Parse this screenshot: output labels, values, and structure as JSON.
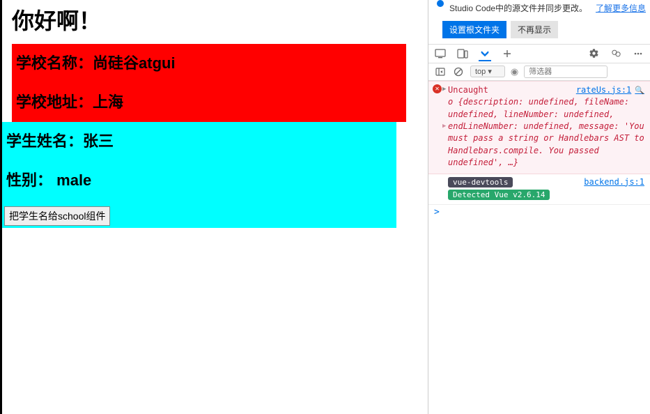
{
  "page": {
    "title": "你好啊！",
    "school": {
      "name_label": "学校名称：",
      "name_value": "尚硅谷atgui",
      "addr_label": "学校地址：",
      "addr_value": "上海"
    },
    "student": {
      "name_label": "学生姓名：",
      "name_value": "张三",
      "sex_label": "性别：",
      "sex_value": "male",
      "button": "把学生名给school组件"
    }
  },
  "devtools": {
    "vscode_hint": "Studio Code中的源文件并同步更改。",
    "vscode_more": "了解更多信息",
    "btn_set_root": "设置根文件夹",
    "btn_dismiss": "不再显示",
    "frame_select": "top",
    "filter_placeholder": "筛选器",
    "error": {
      "title": "Uncaught",
      "source": "rateUs.js:1",
      "body": "o {description: undefined, fileName: undefined, lineNumber: undefined, endLineNumber: undefined, message: 'You must pass a string or Handlebars AST to Handlebars.compile. You passed undefined', …}"
    },
    "vue_msg": {
      "badge1": "vue-devtools",
      "badge2": "Detected Vue v2.6.14",
      "source": "backend.js:1"
    },
    "prompt": ">"
  }
}
